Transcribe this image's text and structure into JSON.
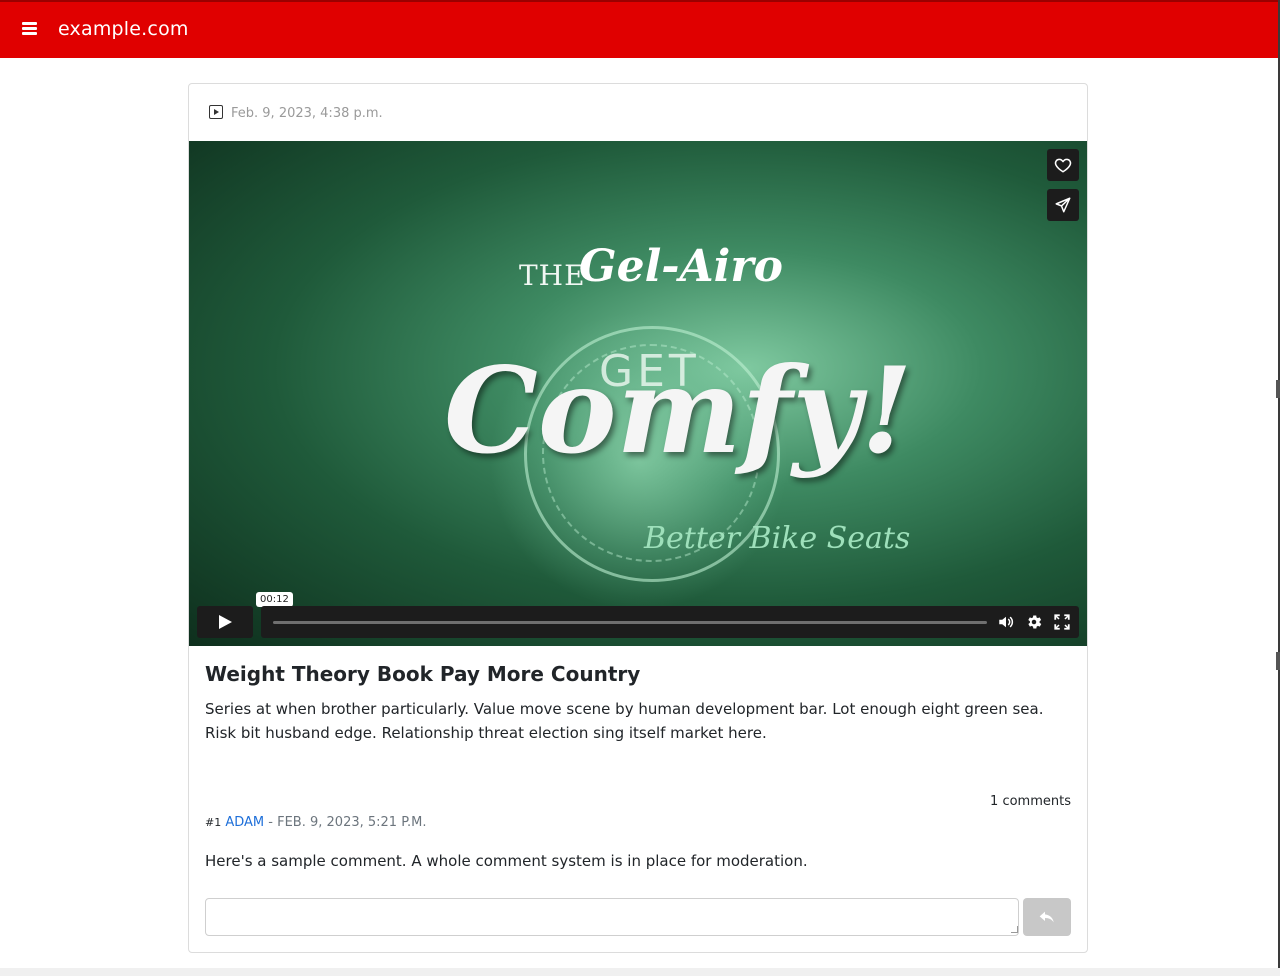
{
  "header": {
    "brand": "example.com",
    "menu_icon": "hamburger-icon",
    "bg_color": "#e00000"
  },
  "post": {
    "type_icon": "video-type-icon",
    "date": "Feb. 9, 2023, 4:38 p.m.",
    "title": "Weight Theory Book Pay More Country",
    "description": "Series at when brother particularly. Value move scene by human development bar. Lot enough eight green sea. Risk bit husband edge. Relationship threat election sing itself market here."
  },
  "video": {
    "logo": {
      "the": "THE",
      "brand": "Gel-Airo",
      "get": "GET",
      "comfy": "Comfy!",
      "tagline": "Better Bike Seats"
    },
    "like_icon": "heart-icon",
    "share_icon": "send-icon",
    "play_icon": "play-icon",
    "time_tooltip": "00:12",
    "volume_icon": "volume-icon",
    "settings_icon": "gear-icon",
    "fullscreen_icon": "fullscreen-icon"
  },
  "comments": {
    "count_label": "1 comments",
    "items": [
      {
        "number": "#1",
        "author": "ADAM",
        "date": "- FEB. 9, 2023, 5:21 P.M.",
        "body": "Here's a sample comment. A whole comment system is in place for moderation."
      }
    ],
    "reply_placeholder": "",
    "reply_icon": "reply-icon"
  }
}
